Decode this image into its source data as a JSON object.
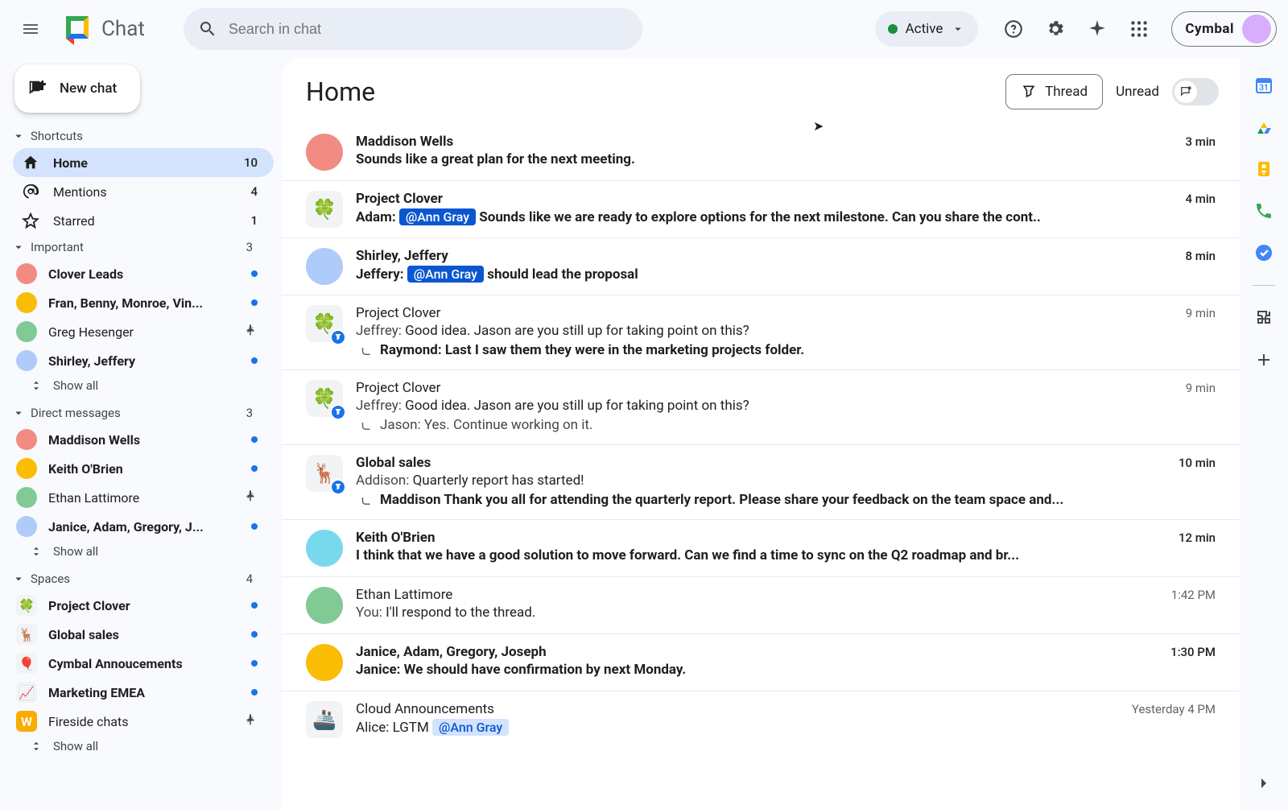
{
  "app": {
    "name": "Chat"
  },
  "header": {
    "search_placeholder": "Search in chat",
    "status_label": "Active",
    "brand_label": "Cymbal"
  },
  "sidebar": {
    "new_chat": "New chat",
    "sections": {
      "shortcuts": {
        "label": "Shortcuts",
        "items": [
          {
            "label": "Home",
            "count": "10",
            "active": true
          },
          {
            "label": "Mentions",
            "count": "4"
          },
          {
            "label": "Starred",
            "count": "1"
          }
        ]
      },
      "important": {
        "label": "Important",
        "count": "3",
        "items": [
          {
            "label": "Clover Leads",
            "unread": true
          },
          {
            "label": "Fran, Benny, Monroe, Vin...",
            "unread": true
          },
          {
            "label": "Greg Hesenger",
            "pinned": true
          },
          {
            "label": "Shirley, Jeffery",
            "unread": true
          }
        ],
        "show_all": "Show all"
      },
      "dms": {
        "label": "Direct messages",
        "count": "3",
        "items": [
          {
            "label": "Maddison Wells",
            "unread": true
          },
          {
            "label": "Keith O'Brien",
            "unread": true
          },
          {
            "label": "Ethan Lattimore",
            "pinned": true
          },
          {
            "label": "Janice, Adam, Gregory, J...",
            "unread": true
          }
        ],
        "show_all": "Show all"
      },
      "spaces": {
        "label": "Spaces",
        "count": "4",
        "items": [
          {
            "label": "Project Clover",
            "unread": true,
            "emoji": "🍀"
          },
          {
            "label": "Global sales",
            "unread": true,
            "emoji": "🦌"
          },
          {
            "label": "Cymbal Annoucements",
            "unread": true,
            "emoji": "🎈"
          },
          {
            "label": "Marketing EMEA",
            "unread": true,
            "emoji": "📈"
          },
          {
            "label": "Fireside chats",
            "pinned": true,
            "emoji": "W",
            "initial": true
          }
        ],
        "show_all": "Show all"
      }
    }
  },
  "main": {
    "title": "Home",
    "thread_btn": "Thread",
    "unread_label": "Unread",
    "conversations": [
      {
        "title": "Maddison Wells",
        "time": "3 min",
        "bold": true,
        "msg": "Sounds like a great plan for the next meeting.",
        "avatar": "person",
        "avclass": "bg1"
      },
      {
        "title": "Project Clover",
        "time": "4 min",
        "bold": true,
        "emoji": "🍀",
        "prefix": "Adam: ",
        "mention": "@Ann Gray",
        "suffix": " Sounds like we are ready to explore options for the next milestone. Can you share the cont.."
      },
      {
        "title": "Shirley, Jeffery",
        "time": "8 min",
        "bold": true,
        "avatar": "group",
        "avclass": "bg4",
        "prefix": "Jeffery: ",
        "mention": "@Ann Gray",
        "suffix": " should lead the proposal"
      },
      {
        "title": "Project Clover",
        "time": "9 min",
        "bold": false,
        "emoji": "🍀",
        "thread": true,
        "line1_sender": "Jeffrey: ",
        "line1": "Good idea. Jason are you still up for taking point on this?",
        "reply_sender": "Raymond: ",
        "reply": "Last I saw them they were in the marketing projects folder.",
        "reply_bold": true
      },
      {
        "title": "Project Clover",
        "time": "9 min",
        "bold": false,
        "emoji": "🍀",
        "thread": true,
        "line1_sender": "Jeffrey: ",
        "line1": "Good idea. Jason are you still up for taking point on this?",
        "reply_sender": "Jason: ",
        "reply": "Yes. Continue working on it."
      },
      {
        "title": "Global sales",
        "time": "10 min",
        "bold": true,
        "emoji": "🦌",
        "thread": true,
        "line1_sender": "Addison: ",
        "line1": "Quarterly report has started!",
        "line1_plain": true,
        "reply_sender": "Maddison ",
        "reply": "Thank you all for attending the quarterly report. Please share your feedback on the team space and...",
        "reply_bold": true
      },
      {
        "title": "Keith O'Brien",
        "time": "12 min",
        "bold": true,
        "avatar": "person",
        "avclass": "bg7",
        "msg": "I think that we have a good solution to move forward. Can we find a time to sync on the Q2 roadmap and br..."
      },
      {
        "title": "Ethan Lattimore",
        "time": "1:42 PM",
        "bold": false,
        "avatar": "person",
        "avclass": "bg3",
        "line1_sender": "You: ",
        "line1": "I'll respond to the thread."
      },
      {
        "title": "Janice, Adam, Gregory, Joseph",
        "time": "1:30 PM",
        "bold": true,
        "avatar": "group",
        "avclass": "bg2",
        "prefix": "Janice: ",
        "suffix": "We should have confirmation by next Monday."
      },
      {
        "title": "Cloud Announcements",
        "time": "Yesterday 4 PM",
        "bold": false,
        "emoji": "🚢",
        "prefix": "Alice: LGTM ",
        "mention": "@Ann Gray",
        "mention_light": true
      }
    ]
  },
  "rail": {
    "icons": [
      "calendar",
      "drive",
      "keep",
      "phone",
      "tasks"
    ]
  }
}
